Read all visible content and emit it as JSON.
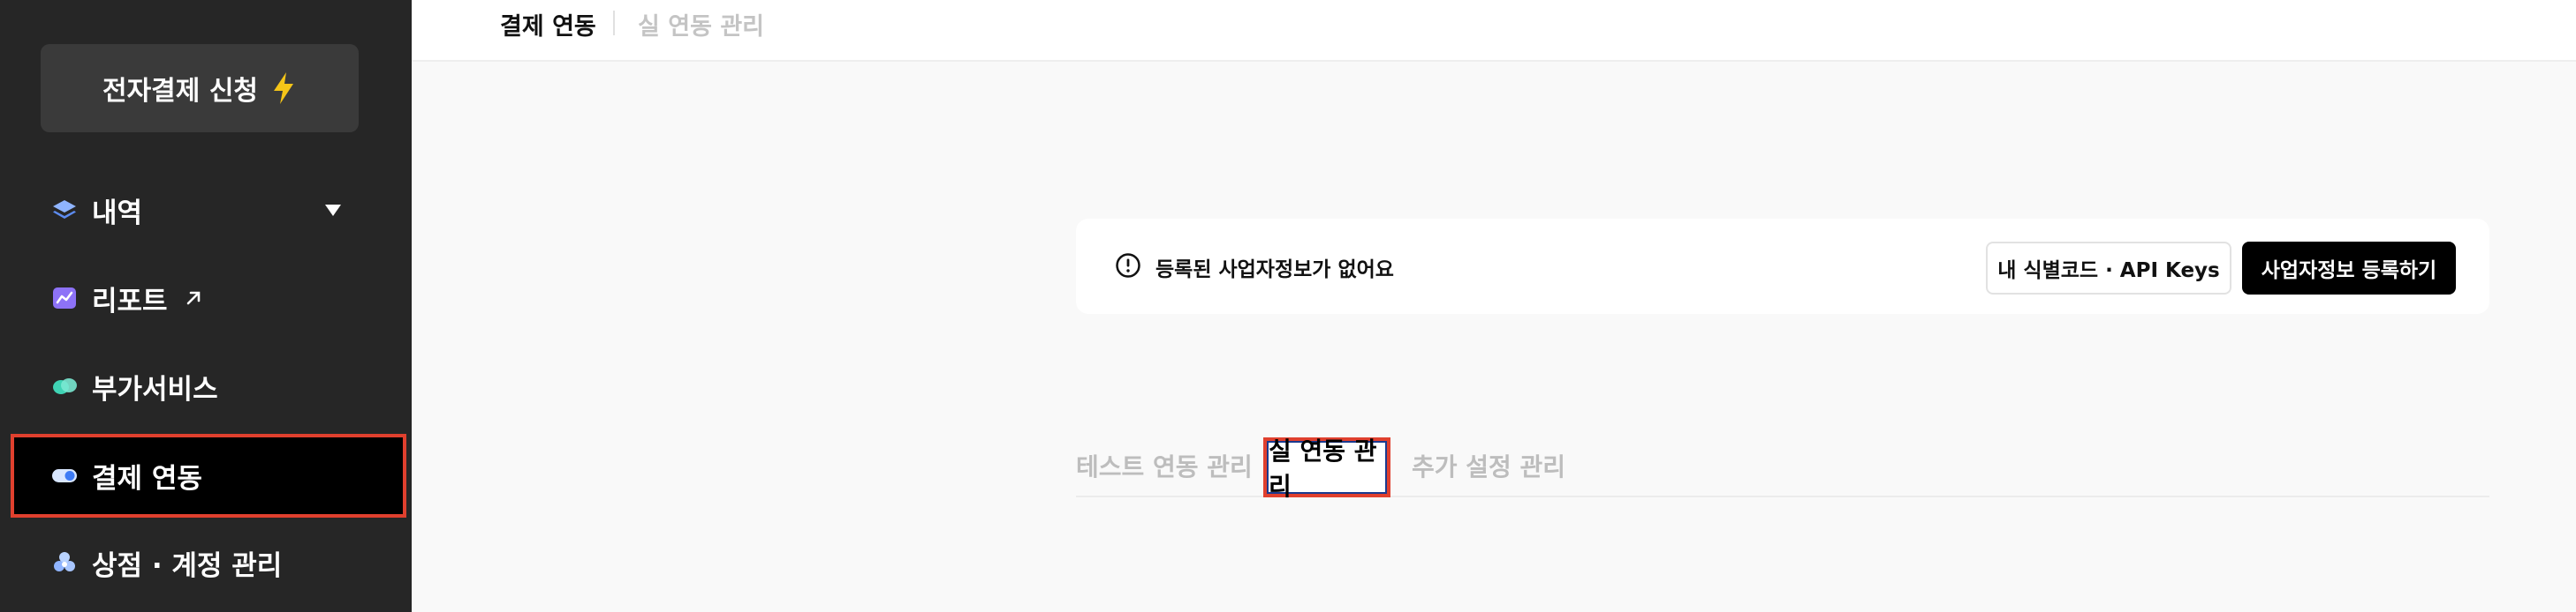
{
  "sidebar": {
    "apply_button": "전자결제 신청",
    "items": [
      {
        "label": "내역",
        "icon": "layers-icon"
      },
      {
        "label": "리포트",
        "icon": "chart-icon"
      },
      {
        "label": "부가서비스",
        "icon": "blobs-icon"
      },
      {
        "label": "결제 연동",
        "icon": "toggle-icon"
      },
      {
        "label": "상점 · 계정 관리",
        "icon": "store-icon"
      }
    ],
    "active_item": "결제 연동"
  },
  "header": {
    "breadcrumbs": [
      "결제 연동",
      "실 연동 관리"
    ]
  },
  "notice": {
    "text": "등록된 사업자정보가 없어요",
    "keys_button": "내 식별코드 · API Keys",
    "register_button": "사업자정보 등록하기"
  },
  "tabs": [
    {
      "label": "테스트 연동 관리",
      "active": false
    },
    {
      "label": "실 연동 관리",
      "active": true
    },
    {
      "label": "추가 설정 관리",
      "active": false
    }
  ],
  "colors": {
    "sidebar_bg": "#262626",
    "highlight": "#e0402e",
    "accent_bolt": "#f5c518"
  }
}
